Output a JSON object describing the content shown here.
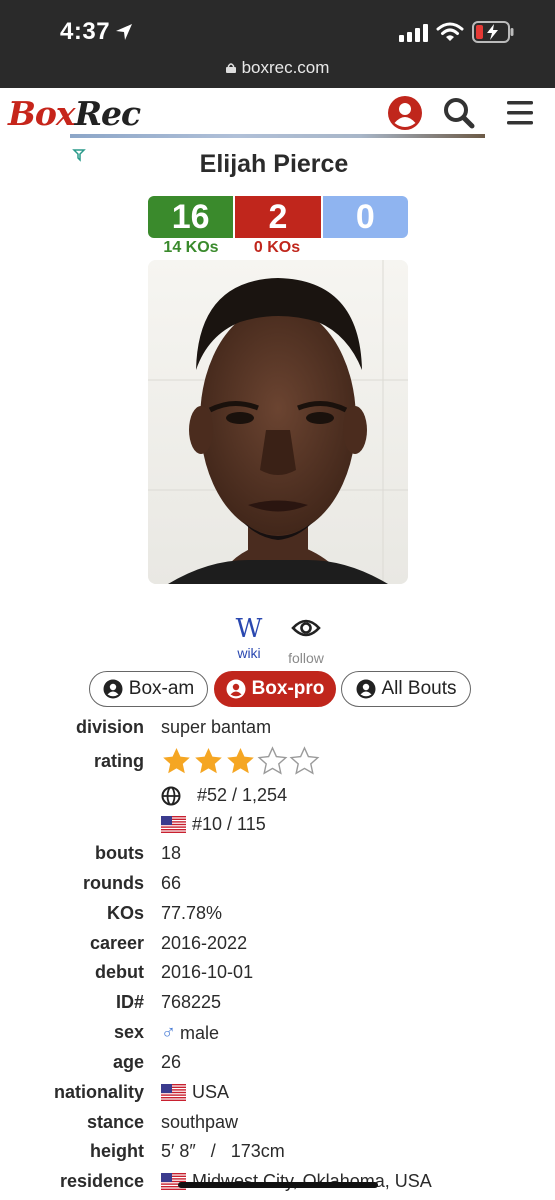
{
  "status_bar": {
    "time": "4:37"
  },
  "browser": {
    "url": "boxrec.com"
  },
  "header": {
    "logo_box": "Box",
    "logo_rec": "Rec"
  },
  "boxer": {
    "name": "Elijah Pierce",
    "record": {
      "wins": "16",
      "losses": "2",
      "draws": "0"
    },
    "kos": {
      "wins": "14 KOs",
      "losses": "0 KOs"
    }
  },
  "links": {
    "wiki_glyph": "W",
    "wiki": "wiki",
    "follow": "follow"
  },
  "tabs": [
    {
      "label": "Box-am",
      "active": false
    },
    {
      "label": "Box-pro",
      "active": true
    },
    {
      "label": "All Bouts",
      "active": false
    }
  ],
  "info": {
    "division": {
      "label": "division",
      "value": "super bantam"
    },
    "rating": {
      "label": "rating",
      "stars": 3,
      "max_stars": 5
    },
    "world_rank": "#52 / 1,254",
    "usa_rank": "#10 / 115",
    "bouts": {
      "label": "bouts",
      "value": "18"
    },
    "rounds": {
      "label": "rounds",
      "value": "66"
    },
    "kos": {
      "label": "KOs",
      "value": "77.78%"
    },
    "career": {
      "label": "career",
      "value": "2016-2022"
    },
    "debut": {
      "label": "debut",
      "value": "2016-10-01"
    },
    "id": {
      "label": "ID#",
      "value": "768225"
    },
    "sex": {
      "label": "sex",
      "value": "male"
    },
    "age": {
      "label": "age",
      "value": "26"
    },
    "nationality": {
      "label": "nationality",
      "value": "USA"
    },
    "stance": {
      "label": "stance",
      "value": "southpaw"
    },
    "height": {
      "label": "height",
      "value": "5′ 8″   /   173cm"
    },
    "residence": {
      "label": "residence",
      "value": "Midwest City, Oklahoma, USA"
    }
  },
  "colors": {
    "brand_red": "#c0261c",
    "win_green": "#3a8a2c",
    "draw_blue": "#8fb4f0",
    "star_gold": "#f5a623"
  },
  "icons": [
    "location-arrow-icon",
    "signal-icon",
    "wifi-icon",
    "battery-icon",
    "lock-icon",
    "user-icon",
    "search-icon",
    "menu-icon",
    "adchoices-icon",
    "wikipedia-icon",
    "eye-icon",
    "globe-icon",
    "us-flag-icon",
    "star-icon",
    "male-icon"
  ]
}
